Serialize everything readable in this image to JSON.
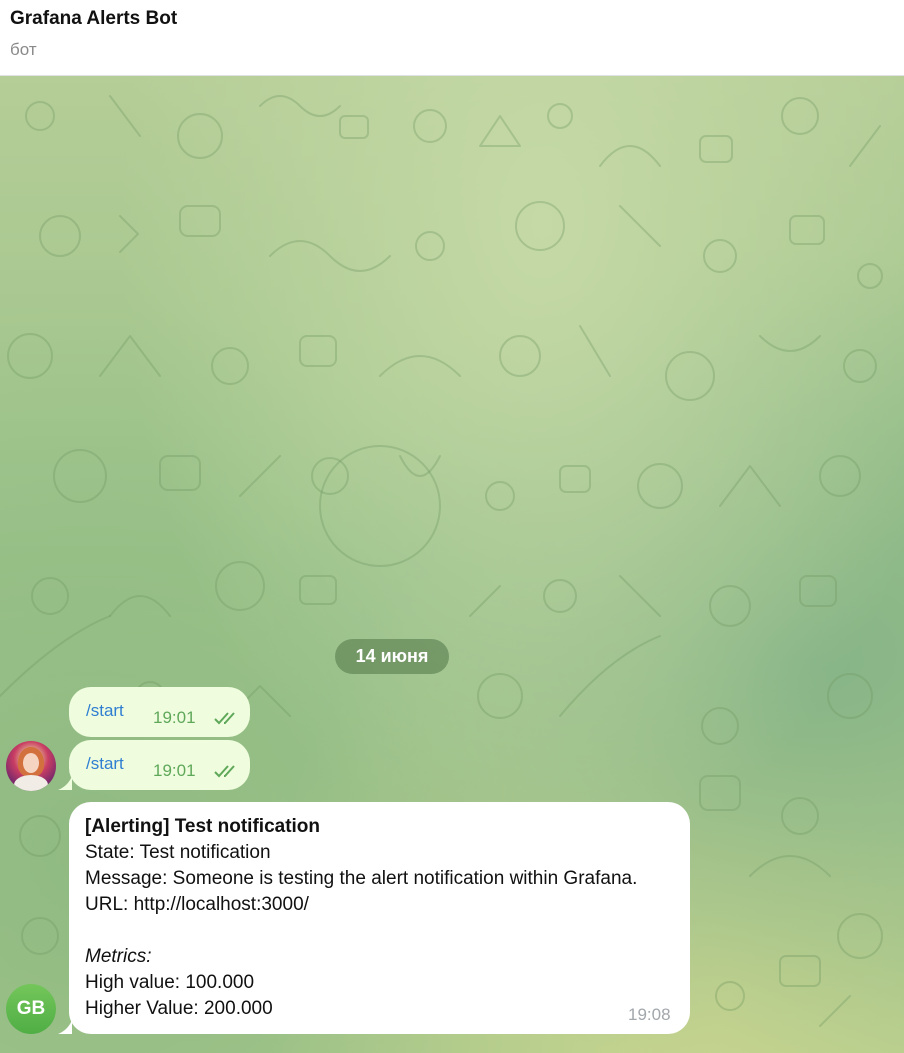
{
  "header": {
    "title": "Grafana Alerts Bot",
    "subtitle": "бот"
  },
  "chat": {
    "date_separator": "14 июня",
    "outgoing": [
      {
        "text": "/start",
        "time": "19:01",
        "status": "read"
      },
      {
        "text": "/start",
        "time": "19:01",
        "status": "read"
      }
    ],
    "incoming": {
      "avatar_initials": "GB",
      "title": "[Alerting] Test notification",
      "state": "State: Test notification",
      "message": "Message: Someone is testing the alert notification within Grafana.",
      "url": "URL: http://localhost:3000/",
      "metrics_label": "Metrics:",
      "metric_1": "High value: 100.000",
      "metric_2": "Higher Value: 200.000",
      "time": "19:08"
    }
  },
  "colors": {
    "outgoing_bubble": "#effdde",
    "incoming_bubble": "#ffffff",
    "link": "#2f7ed2",
    "read_check": "#5fa85a",
    "avatar_gb": "#5bb74b"
  }
}
